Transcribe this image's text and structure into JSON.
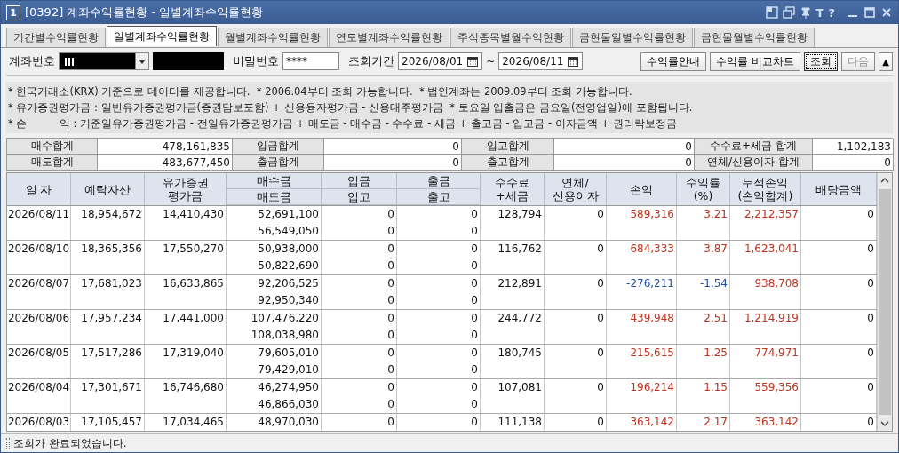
{
  "window": {
    "number": "1",
    "title": "[0392] 계좌수익률현황 - 일별계좌수익률현황",
    "title_buttons": [
      "T",
      "?"
    ]
  },
  "tabs": [
    {
      "label": "기간별수익률현황",
      "selected": false
    },
    {
      "label": "일별계좌수익률현황",
      "selected": true
    },
    {
      "label": "월별계좌수익률현황",
      "selected": false
    },
    {
      "label": "연도별계좌수익률현황",
      "selected": false
    },
    {
      "label": "주식종목별월수익현황",
      "selected": false
    },
    {
      "label": "금현물일별수익률현황",
      "selected": false
    },
    {
      "label": "금현물월별수익률현황",
      "selected": false
    }
  ],
  "query": {
    "account_label": "계좌번호",
    "password_label": "비밀번호",
    "password_value": "****",
    "period_label": "조회기간",
    "start_date": "2026/08/01",
    "separator": "~",
    "end_date": "2026/08/11",
    "buttons": [
      {
        "label": "수익률안내",
        "disabled": false,
        "focused": false
      },
      {
        "label": "수익률 비교차트",
        "disabled": false,
        "focused": false
      },
      {
        "label": "조회",
        "disabled": false,
        "focused": true
      },
      {
        "label": "다음",
        "disabled": true,
        "focused": false
      }
    ],
    "collapse_button": "▲"
  },
  "notes": [
    "* 한국거래소(KRX) 기준으로 데이터를 제공합니다.  * 2006.04부터 조회 가능합니다.  * 법인계좌는 2009.09부터 조회 가능합니다.",
    "* 유가증권평가금 : 일반유가증권평가금(증권담보포함) + 신용융자평가금 - 신용대주평가금  * 토요일 입출금은 금요일(전영업일)에 포함됩니다.",
    "* 손          익 : 기준일유가증권평가금 - 전일유가증권평가금 + 매도금 - 매수금 - 수수료 - 세금 + 출고금 - 입고금 - 이자금액 + 권리락보정금"
  ],
  "summary": [
    [
      {
        "label": "매수합계",
        "value": "478,161,835"
      },
      {
        "label": "입금합계",
        "value": "0"
      },
      {
        "label": "입고합계",
        "value": "0"
      },
      {
        "label": "수수료+세금 합계",
        "value": "1,102,183"
      }
    ],
    [
      {
        "label": "매도합계",
        "value": "483,677,450"
      },
      {
        "label": "출금합계",
        "value": "0"
      },
      {
        "label": "출고합계",
        "value": "0"
      },
      {
        "label": "연체/신용이자 합계",
        "value": "0"
      }
    ]
  ],
  "columns": {
    "date": "일 자",
    "deposit_assets": "예탁자산",
    "securities_value": "유가증권\n평가금",
    "buy": "매수금",
    "sell": "매도금",
    "cash_in": "입금",
    "stock_in": "입고",
    "cash_out": "출금",
    "stock_out": "출고",
    "fee_tax": "수수료\n+세금",
    "interest": "연체/\n신용이자",
    "profit": "손익",
    "rate": "수익률\n(%)",
    "cumulative": "누적손익\n(손익합계)",
    "dividend": "배당금액"
  },
  "rows": [
    {
      "date": "2026/08/11",
      "deposit_assets": "18,954,672",
      "securities_value": "14,410,430",
      "buy": "52,691,100",
      "sell": "56,549,050",
      "cash_in": "0",
      "stock_in": "0",
      "cash_out": "0",
      "stock_out": "0",
      "fee_tax": "128,794",
      "interest": "0",
      "profit": {
        "text": "589,316",
        "color": "#c0321e"
      },
      "rate": {
        "text": "3.21",
        "color": "#c0321e"
      },
      "cumulative": {
        "text": "2,212,357",
        "color": "#c0321e"
      },
      "dividend": "0"
    },
    {
      "date": "2026/08/10",
      "deposit_assets": "18,365,356",
      "securities_value": "17,550,270",
      "buy": "50,938,000",
      "sell": "50,822,690",
      "cash_in": "0",
      "stock_in": "0",
      "cash_out": "0",
      "stock_out": "0",
      "fee_tax": "116,762",
      "interest": "0",
      "profit": {
        "text": "684,333",
        "color": "#c0321e"
      },
      "rate": {
        "text": "3.87",
        "color": "#c0321e"
      },
      "cumulative": {
        "text": "1,623,041",
        "color": "#c0321e"
      },
      "dividend": "0"
    },
    {
      "date": "2026/08/07",
      "deposit_assets": "17,681,023",
      "securities_value": "16,633,865",
      "buy": "92,206,525",
      "sell": "92,950,340",
      "cash_in": "0",
      "stock_in": "0",
      "cash_out": "0",
      "stock_out": "0",
      "fee_tax": "212,891",
      "interest": "0",
      "profit": {
        "text": "-276,211",
        "color": "#1e4fa0"
      },
      "rate": {
        "text": "-1.54",
        "color": "#1e4fa0"
      },
      "cumulative": {
        "text": "938,708",
        "color": "#c0321e"
      },
      "dividend": "0"
    },
    {
      "date": "2026/08/06",
      "deposit_assets": "17,957,234",
      "securities_value": "17,441,000",
      "buy": "107,476,220",
      "sell": "108,038,980",
      "cash_in": "0",
      "stock_in": "0",
      "cash_out": "0",
      "stock_out": "0",
      "fee_tax": "244,772",
      "interest": "0",
      "profit": {
        "text": "439,948",
        "color": "#c0321e"
      },
      "rate": {
        "text": "2.51",
        "color": "#c0321e"
      },
      "cumulative": {
        "text": "1,214,919",
        "color": "#c0321e"
      },
      "dividend": "0"
    },
    {
      "date": "2026/08/05",
      "deposit_assets": "17,517,286",
      "securities_value": "17,319,040",
      "buy": "79,605,010",
      "sell": "79,429,010",
      "cash_in": "0",
      "stock_in": "0",
      "cash_out": "0",
      "stock_out": "0",
      "fee_tax": "180,745",
      "interest": "0",
      "profit": {
        "text": "215,615",
        "color": "#c0321e"
      },
      "rate": {
        "text": "1.25",
        "color": "#c0321e"
      },
      "cumulative": {
        "text": "774,971",
        "color": "#c0321e"
      },
      "dividend": "0"
    },
    {
      "date": "2026/08/04",
      "deposit_assets": "17,301,671",
      "securities_value": "16,746,680",
      "buy": "46,274,950",
      "sell": "46,866,030",
      "cash_in": "0",
      "stock_in": "0",
      "cash_out": "0",
      "stock_out": "0",
      "fee_tax": "107,081",
      "interest": "0",
      "profit": {
        "text": "196,214",
        "color": "#c0321e"
      },
      "rate": {
        "text": "1.15",
        "color": "#c0321e"
      },
      "cumulative": {
        "text": "559,356",
        "color": "#c0321e"
      },
      "dividend": "0"
    },
    {
      "date": "2026/08/03",
      "deposit_assets": "17,105,457",
      "securities_value": "17,034,465",
      "buy": "48,970,030",
      "cash_in": "0",
      "cash_out": "0",
      "fee_tax": "111,138",
      "interest": "0",
      "profit": {
        "text": "363,142",
        "color": "#c0321e"
      },
      "rate": {
        "text": "2.17",
        "color": "#c0321e"
      },
      "cumulative": {
        "text": "363,142",
        "color": "#c0321e"
      },
      "dividend": "0"
    }
  ],
  "status": "조회가 완료되었습니다."
}
